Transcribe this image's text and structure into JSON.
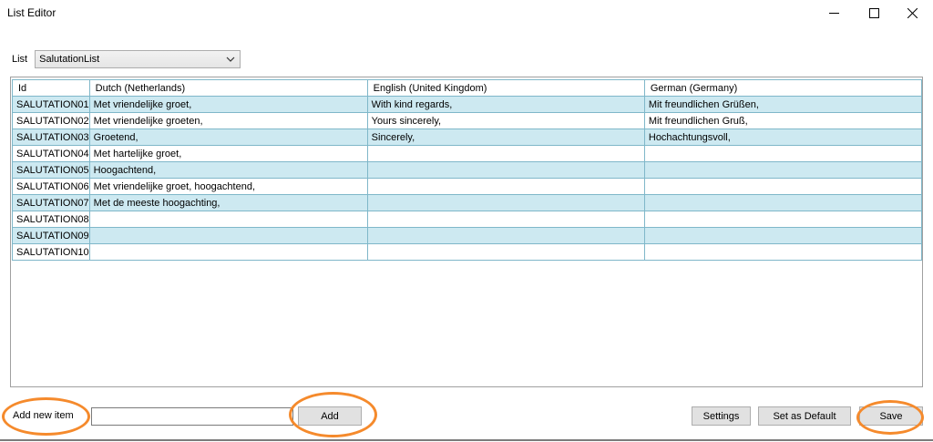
{
  "window": {
    "title": "List Editor"
  },
  "list_selector": {
    "label": "List",
    "selected": "SalutationList"
  },
  "grid": {
    "columns": [
      "Id",
      "Dutch (Netherlands)",
      "English (United Kingdom)",
      "German (Germany)"
    ],
    "rows": [
      {
        "id": "SALUTATION01",
        "nl": "Met vriendelijke groet,",
        "en": "With kind regards,",
        "de": "Mit freundlichen Grüßen,"
      },
      {
        "id": "SALUTATION02",
        "nl": "Met vriendelijke groeten,",
        "en": "Yours sincerely,",
        "de": "Mit freundlichen Gruß,"
      },
      {
        "id": "SALUTATION03",
        "nl": "Groetend,",
        "en": "Sincerely,",
        "de": "Hochachtungsvoll,"
      },
      {
        "id": "SALUTATION04",
        "nl": "Met hartelijke groet,",
        "en": "",
        "de": ""
      },
      {
        "id": "SALUTATION05",
        "nl": "Hoogachtend,",
        "en": "",
        "de": ""
      },
      {
        "id": "SALUTATION06",
        "nl": "Met vriendelijke groet, hoogachtend,",
        "en": "",
        "de": ""
      },
      {
        "id": "SALUTATION07",
        "nl": "Met de meeste hoogachting,",
        "en": "",
        "de": ""
      },
      {
        "id": "SALUTATION08",
        "nl": "",
        "en": "",
        "de": ""
      },
      {
        "id": "SALUTATION09",
        "nl": "",
        "en": "",
        "de": ""
      },
      {
        "id": "SALUTATION10",
        "nl": "",
        "en": "",
        "de": ""
      }
    ]
  },
  "footer": {
    "new_item_label": "Add new item",
    "new_item_value": "",
    "add_label": "Add",
    "settings_label": "Settings",
    "set_default_label": "Set as Default",
    "save_label": "Save"
  },
  "colors": {
    "row_alt": "#cde9f1",
    "grid_line": "#7fb7c9",
    "highlight_ring": "#f58a2c"
  }
}
